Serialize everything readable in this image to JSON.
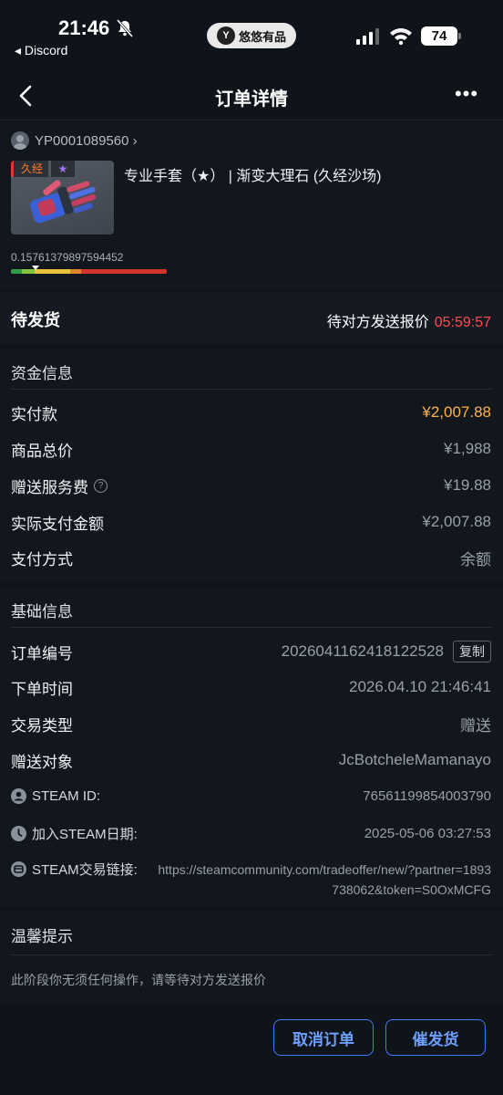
{
  "status_bar": {
    "time": "21:46",
    "back_app": "◂ Discord",
    "center_pill": "悠悠有品",
    "center_logo": "Y",
    "battery": "74"
  },
  "nav": {
    "title": "订单详情",
    "more": "•••"
  },
  "product": {
    "order_ref": "YP0001089560 ›",
    "wear_tag": "久经",
    "star_tag": "★",
    "name": "专业手套（★） | 渐变大理石 (久经沙场)",
    "float_value": "0.15761379897594452",
    "float_fraction": 0.1576
  },
  "status": {
    "state": "待发货",
    "waiting": "待对方发送报价",
    "countdown": "05:59:57"
  },
  "funds": {
    "heading": "资金信息",
    "rows": [
      {
        "label": "实付款",
        "value": "¥2,007.88"
      },
      {
        "label": "商品总价",
        "value": "¥1,988"
      },
      {
        "label": "赠送服务费",
        "value": "¥19.88"
      },
      {
        "label": "实际支付金额",
        "value": "¥2,007.88"
      },
      {
        "label": "支付方式",
        "value": "余额"
      }
    ]
  },
  "basic": {
    "heading": "基础信息",
    "order_no_label": "订单编号",
    "order_no": "2026041162418122528",
    "copy_label": "复制",
    "order_time_label": "下单时间",
    "order_time": "2026.04.10 21:46:41",
    "trade_type_label": "交易类型",
    "trade_type": "赠送",
    "recipient_label": "赠送对象",
    "recipient": "JcBotcheleMamanayo",
    "steam_id_label": "STEAM ID:",
    "steam_id": "76561199854003790",
    "join_date_label": "加入STEAM日期:",
    "join_date": "2025-05-06 03:27:53",
    "trade_link_label": "STEAM交易链接:",
    "trade_link": "https://steamcommunity.com/tradeoffer/new/?partner=1893738062&token=S0OxMCFG"
  },
  "tips": {
    "heading": "温馨提示",
    "line1": "此阶段你无须任何操作，请等待对方发送报价"
  },
  "actions": {
    "cancel": "取消订单",
    "urge": "催发货"
  },
  "colors": {
    "accent_blue": "#3f7bff",
    "price_orange": "#ffb24a",
    "timer_red": "#ff4d4f"
  }
}
